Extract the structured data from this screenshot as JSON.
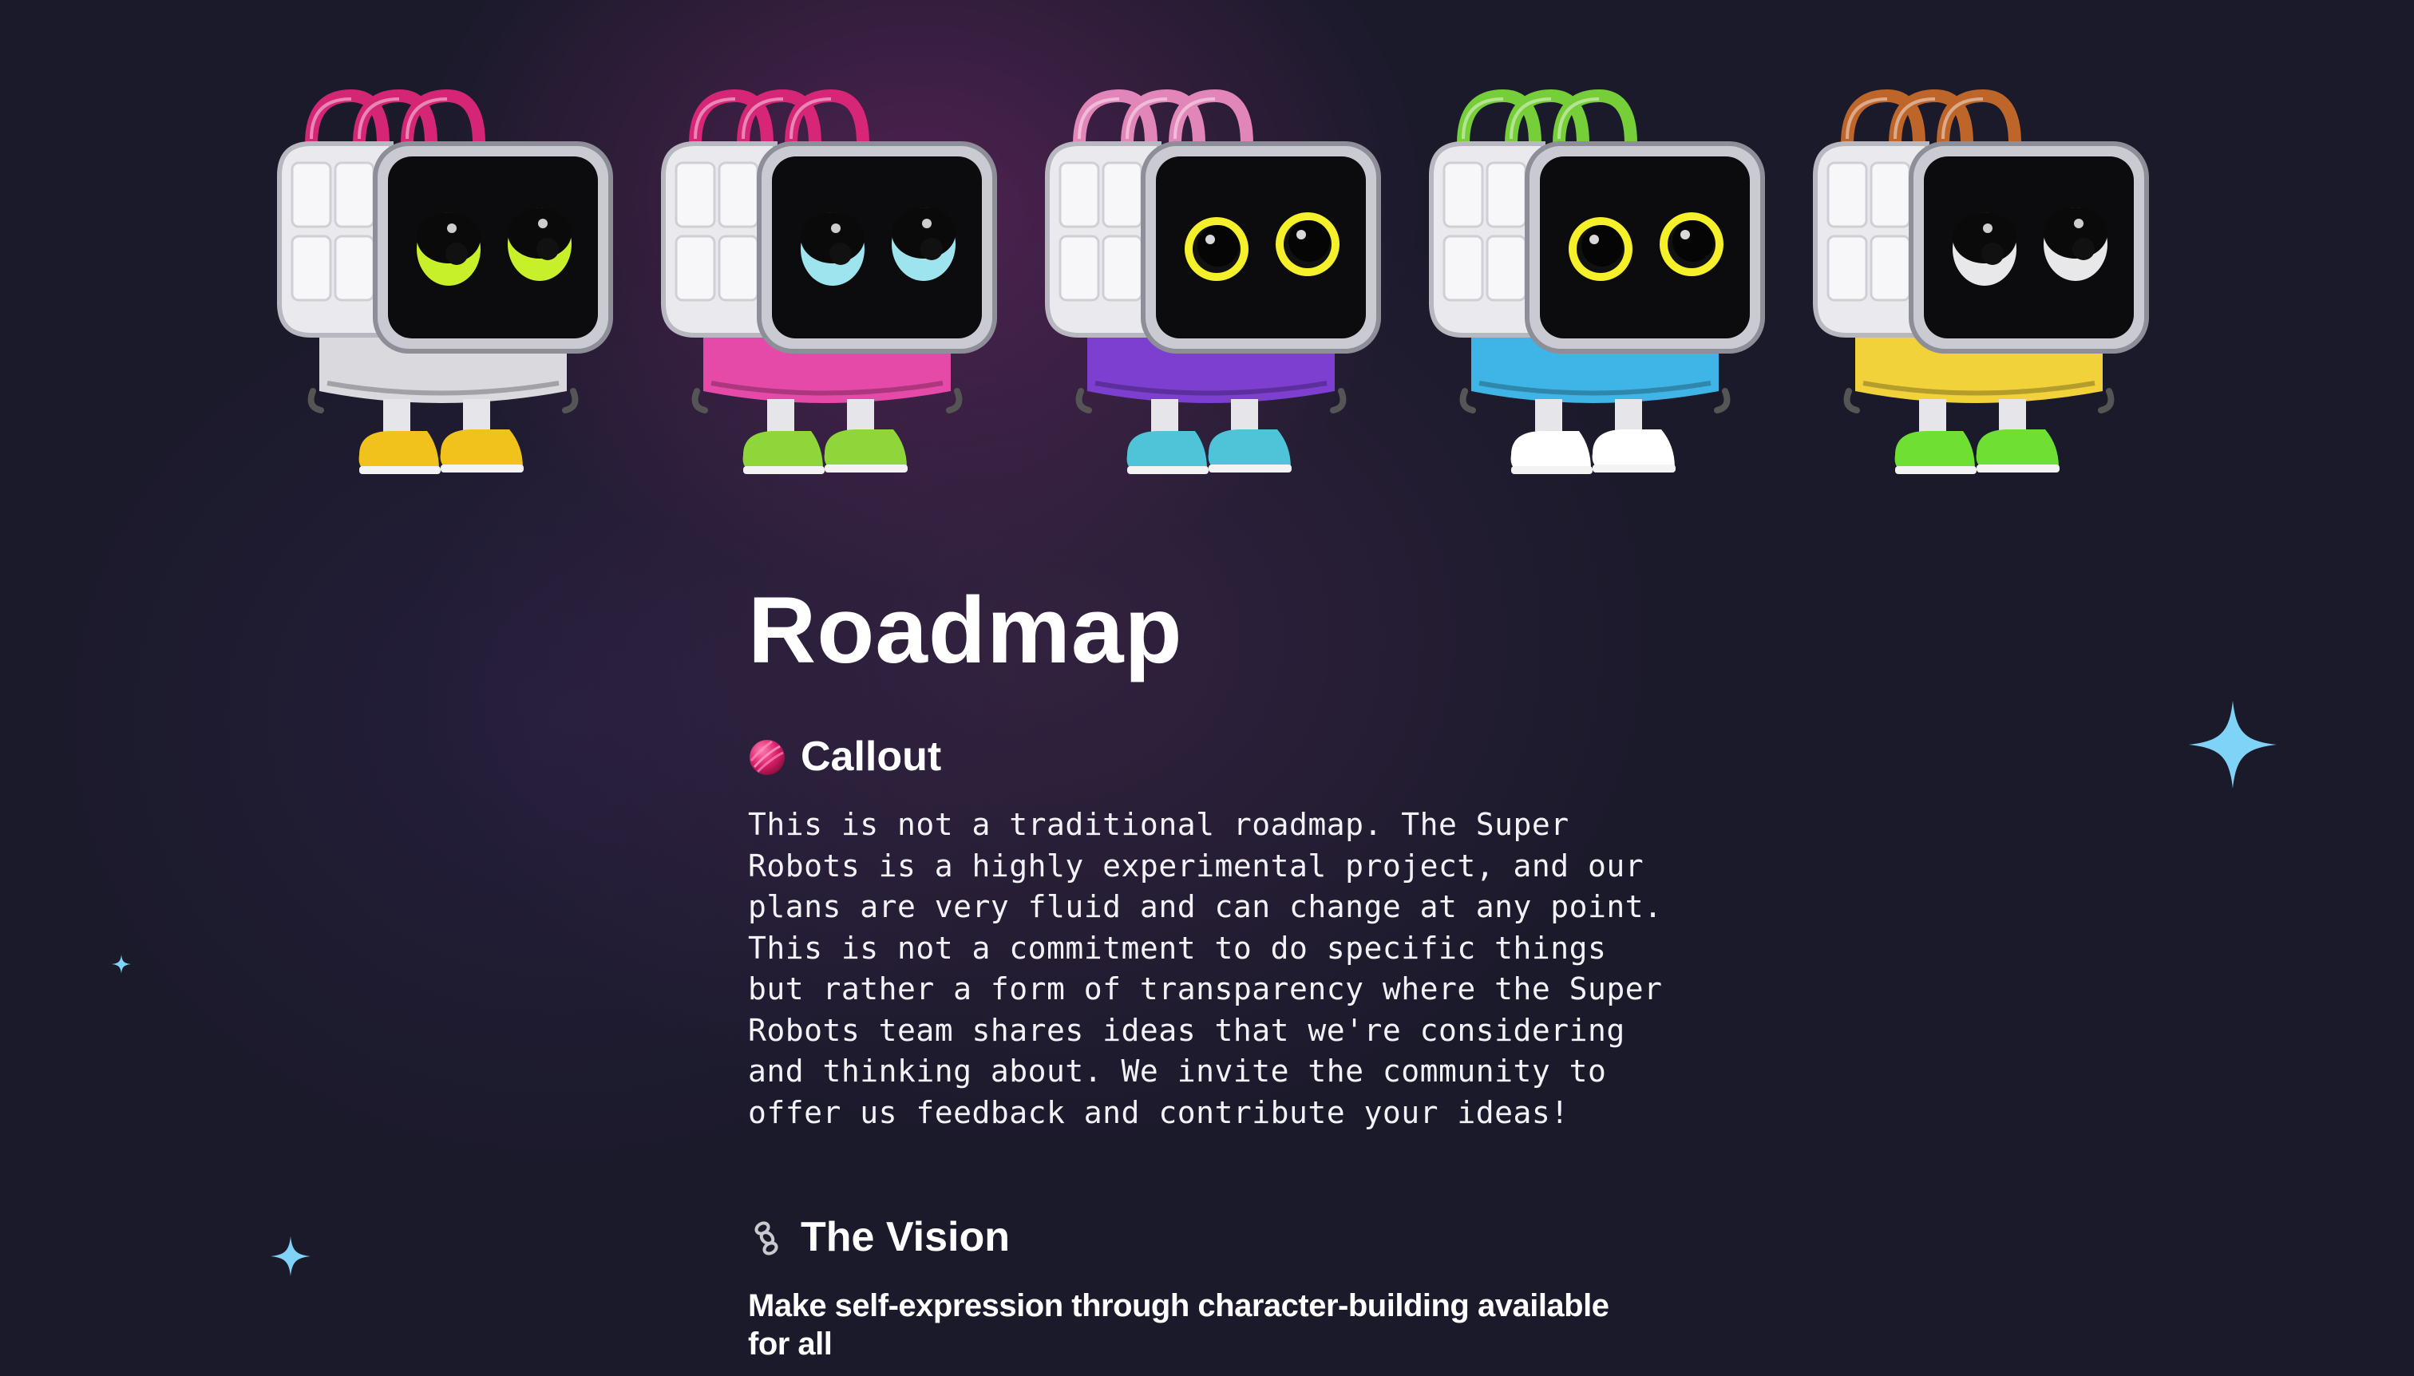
{
  "page": {
    "title": "Roadmap"
  },
  "robots": [
    {
      "name": "robot-green-eyes",
      "eye_color": "#c8f02a",
      "hoodie_color": "#d9d9de",
      "shoe_color": "#f1c21b",
      "tubes_color": "#e0267a"
    },
    {
      "name": "robot-blue-eyes",
      "eye_color": "#9ee4ee",
      "hoodie_color": "#e64aa8",
      "shoe_color": "#8fd63a",
      "tubes_color": "#e0267a"
    },
    {
      "name": "robot-yellow-ring-eyes",
      "eye_color": "#f5f02a",
      "hoodie_color": "#7d3fd0",
      "shoe_color": "#4fc3d8",
      "tubes_color": "#ec8cc0"
    },
    {
      "name": "robot-yellow-ring-eyes-2",
      "eye_color": "#f5f02a",
      "hoodie_color": "#3fb4e6",
      "shoe_color": "#ffffff",
      "tubes_color": "#7bd83a"
    },
    {
      "name": "robot-white-eyes",
      "eye_color": "#e8e8ea",
      "hoodie_color": "#f2d23a",
      "shoe_color": "#6fe033",
      "tubes_color": "#c76a2a"
    }
  ],
  "callout": {
    "icon": "pink-ball-icon",
    "heading": "Callout",
    "body": "This is not a traditional roadmap. The Super Robots is a highly experimental project, and our plans are very fluid and can change at any point. This is not a commitment to do specific things but rather a form of transparency where the Super Robots team shares ideas that we're considering and thinking about. We invite the community to offer us feedback and contribute your ideas!"
  },
  "vision": {
    "icon": "chain-icon",
    "heading": "The Vision",
    "subheading": "Make self-expression through character-building available for all"
  },
  "colors": {
    "background": "#1b1a2b",
    "sparkle": "#7fd3f7",
    "text": "#ffffff"
  }
}
